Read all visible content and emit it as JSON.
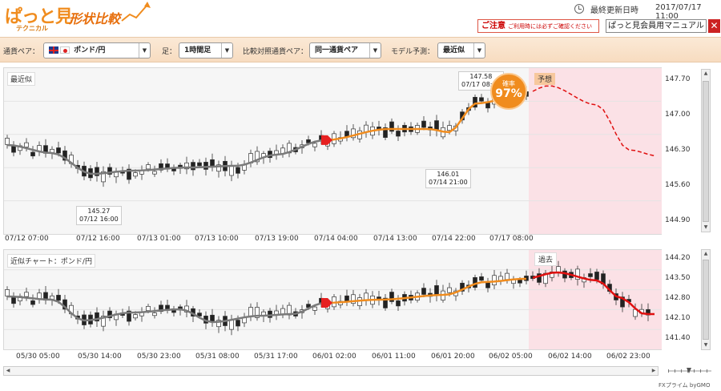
{
  "header": {
    "logo_main": "ぱっと見",
    "logo_sub": "テクニカル",
    "logo_title": "形状比較",
    "updated_label": "最終更新日時",
    "updated_time": "2017/07/17 11:00",
    "notice_title": "ご注意",
    "notice_text": "ご利用時には必ずご確認ください",
    "manual_label": "ぱっと見会員用マニュアル",
    "close_label": "✕"
  },
  "toolbar": {
    "pair_label": "通貨ペア：",
    "pair_value": "ポンド/円",
    "bar_label": "足：",
    "bar_value": "1時間足",
    "compare_label": "比較対照通貨ペア：",
    "compare_value": "同一通貨ペア",
    "model_label": "モデル予測：",
    "model_value": "最近似"
  },
  "panel1": {
    "tag": "最近似",
    "zone_tag": "予想",
    "probability_label": "確率",
    "probability_value": "97%",
    "y_ticks": [
      "147.70",
      "147.00",
      "146.30",
      "145.60",
      "144.90"
    ],
    "x_ticks": [
      "07/12 07:00",
      "07/12 16:00",
      "07/13 01:00",
      "07/13 10:00",
      "07/13 19:00",
      "07/14 04:00",
      "07/14 13:00",
      "07/14 22:00",
      "07/17 08:00"
    ],
    "annotations": [
      {
        "value": "145.27",
        "time": "07/12 16:00"
      },
      {
        "value": "146.01",
        "time": "07/14 21:00"
      },
      {
        "value": "147.58",
        "time": "07/17 08:00"
      }
    ]
  },
  "panel2": {
    "tag": "近似チャート：ポンド/円",
    "zone_tag": "過去",
    "y_ticks": [
      "144.20",
      "143.50",
      "142.80",
      "142.10",
      "141.40"
    ],
    "x_ticks": [
      "05/30 05:00",
      "05/30 14:00",
      "05/30 23:00",
      "05/31 08:00",
      "05/31 17:00",
      "06/01 02:00",
      "06/01 11:00",
      "06/01 20:00",
      "06/02 05:00",
      "06/02 14:00",
      "06/02 23:00"
    ]
  },
  "footer": {
    "brand": "FXプライム byGMO"
  },
  "colors": {
    "accent": "#f08c1e",
    "forecast_zone": "#fbe1e6",
    "ma_gray": "#7a7a7a",
    "ma_orange": "#f08c1e",
    "forecast_red": "#e01010"
  }
}
